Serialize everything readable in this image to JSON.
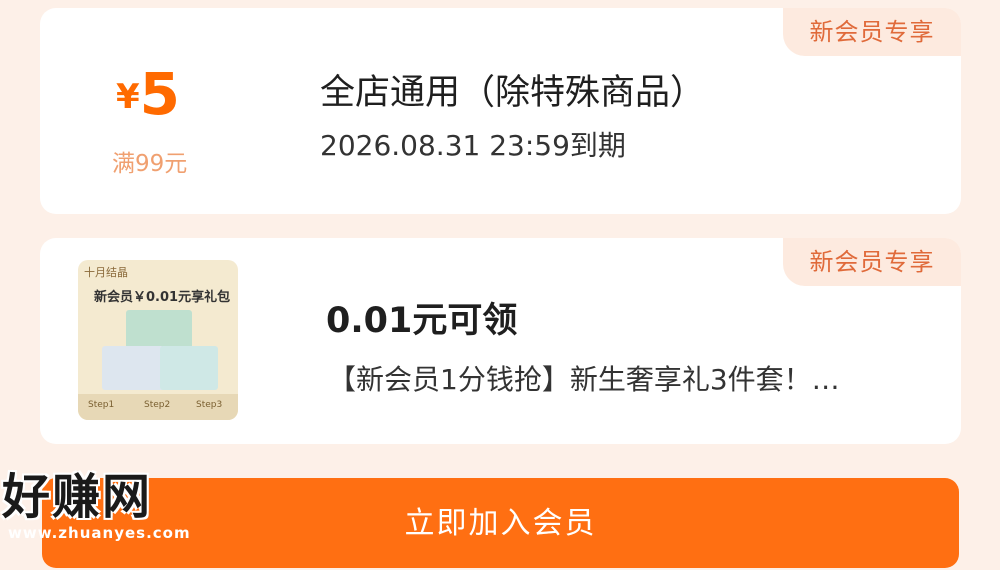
{
  "coupon": {
    "badge": "新会员专享",
    "currency": "¥",
    "amount": "5",
    "threshold": "满99元",
    "title": "全店通用（除特殊商品）",
    "expire": "2026.08.31 23:59到期"
  },
  "gift": {
    "badge": "新会员专享",
    "thumb_brand": "十月结晶",
    "thumb_title": "新会员￥0.01元享礼包",
    "thumb_steps": [
      "Step1",
      "Step2",
      "Step3"
    ],
    "title": "0.01元可领",
    "desc": "【新会员1分钱抢】新生奢享礼3件套！…"
  },
  "join_button": "立即加入会员",
  "watermark": {
    "text": "好赚网",
    "url": "www.zhuanyes.com"
  },
  "colors": {
    "accent": "#ff6f12",
    "amount": "#ff6a00",
    "badge_bg": "#fdeadf",
    "badge_text": "#e06a3a",
    "page_bg": "#fdf0e8"
  }
}
